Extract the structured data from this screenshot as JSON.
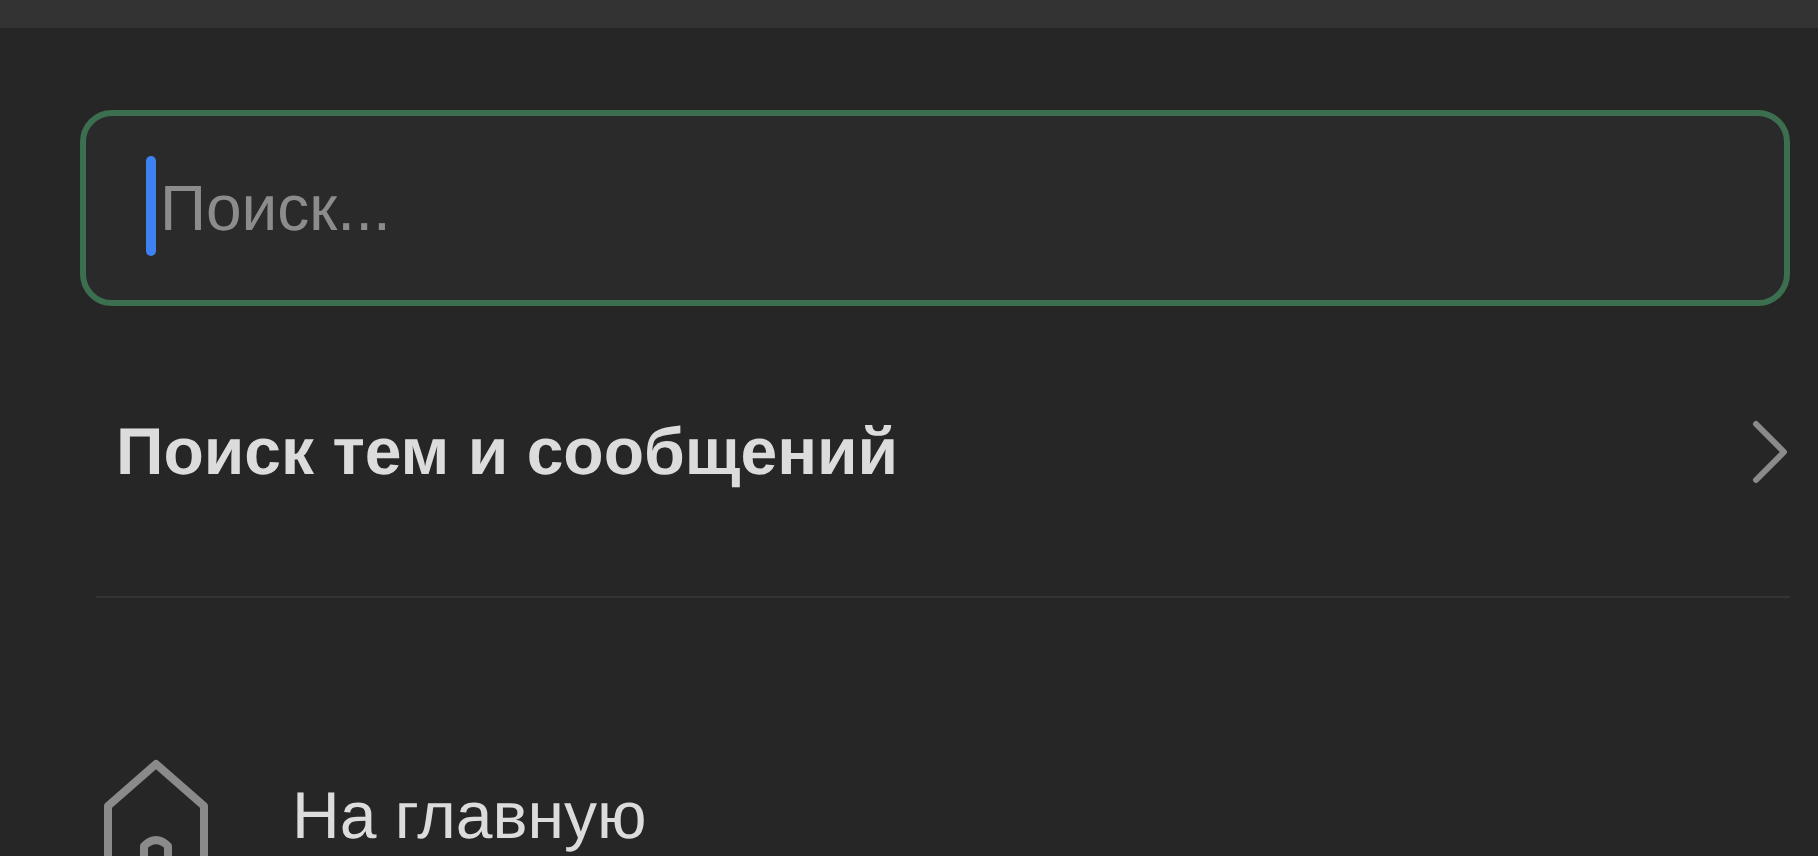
{
  "search": {
    "placeholder": "Поиск...",
    "focused": true
  },
  "search_link": {
    "label": "Поиск тем и сообщений"
  },
  "menu": [
    {
      "label": "На главную"
    }
  ]
}
